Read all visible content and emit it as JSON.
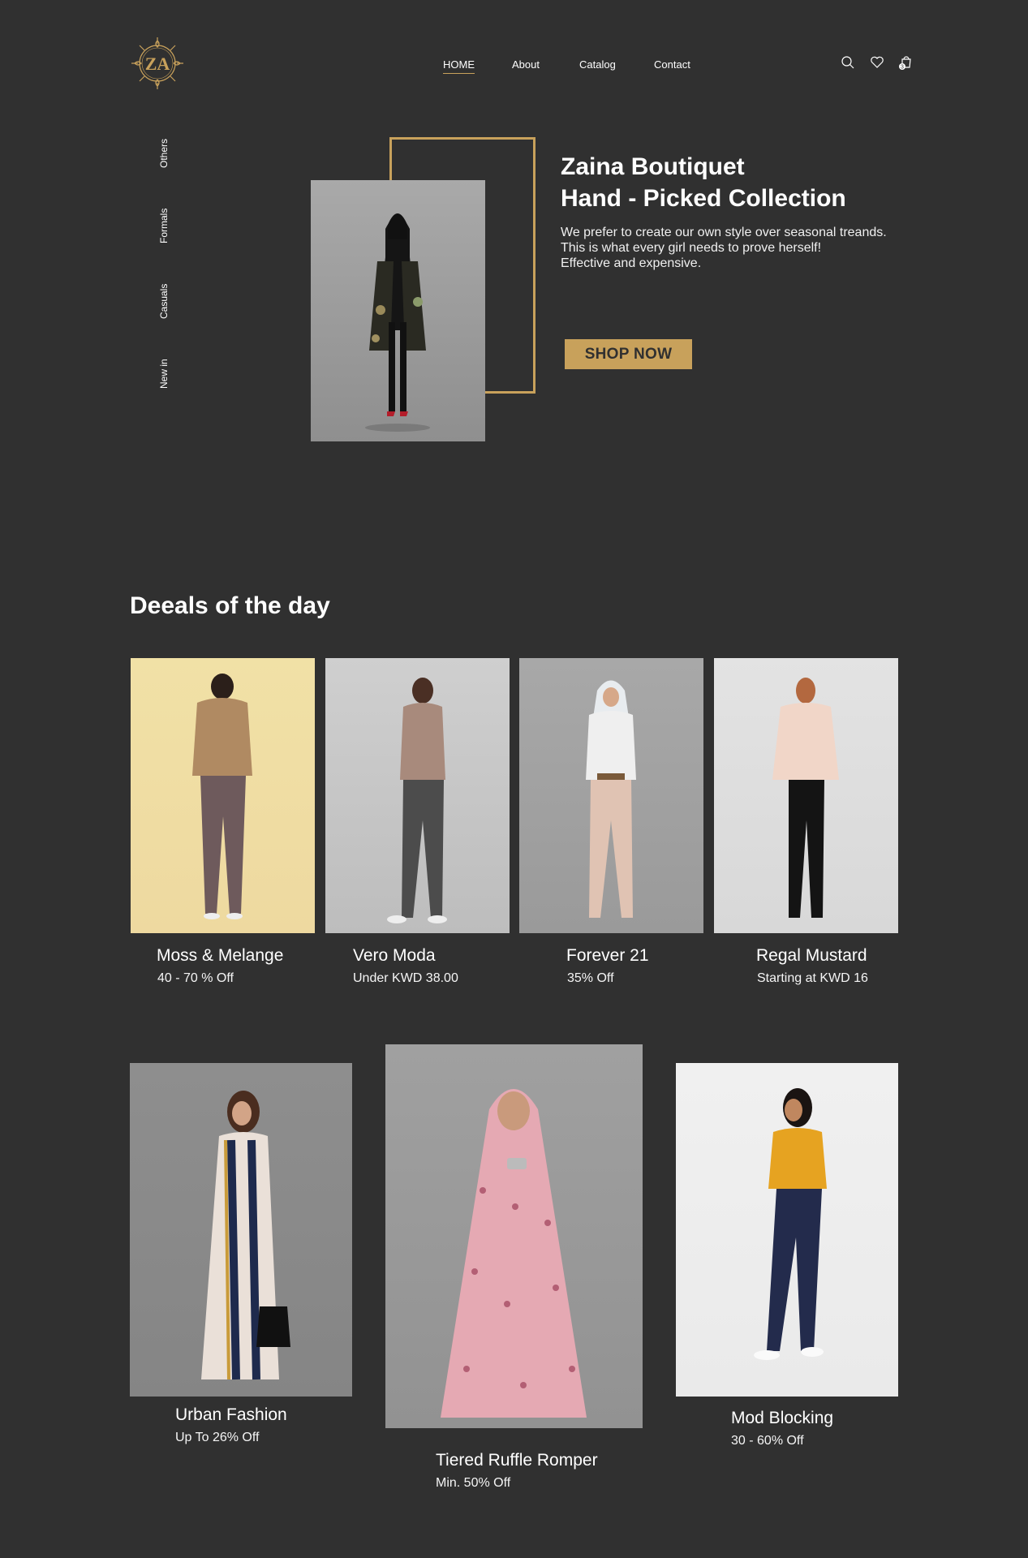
{
  "header": {
    "logo_text": "ZA",
    "nav": [
      {
        "label": "HOME",
        "active": true
      },
      {
        "label": "About",
        "active": false
      },
      {
        "label": "Catalog",
        "active": false
      },
      {
        "label": "Contact",
        "active": false
      }
    ],
    "icons": [
      "search-icon",
      "heart-icon",
      "cart-icon"
    ],
    "cart_count": "3"
  },
  "side_nav": [
    "Others",
    "Formals",
    "Casuals",
    "New in"
  ],
  "hero": {
    "title_line1": "Zaina Boutiquet",
    "title_line2": "Hand - Picked Collection",
    "desc_line1": "We prefer to create our own style over seasonal treands.",
    "desc_line2": "This is what every girl needs to prove herself!",
    "desc_line3": "Effective and expensive.",
    "cta": "SHOP NOW"
  },
  "deals": {
    "title": "Deeals of the day",
    "row1": [
      {
        "name": "Moss & Melange",
        "deal": "40 - 70 % Off"
      },
      {
        "name": "Vero Moda",
        "deal": "Under KWD 38.00"
      },
      {
        "name": "Forever 21",
        "deal": "35% Off"
      },
      {
        "name": "Regal Mustard",
        "deal": "Starting at KWD 16"
      }
    ],
    "row2": [
      {
        "name": "Urban Fashion",
        "deal": "Up To  26% Off"
      },
      {
        "name": "Tiered Ruffle Romper",
        "deal": "Min. 50% Off"
      },
      {
        "name": "Mod Blocking",
        "deal": "30 - 60% Off"
      }
    ]
  },
  "colors": {
    "background": "#303030",
    "accent": "#c8a15b",
    "text": "#ffffff"
  }
}
